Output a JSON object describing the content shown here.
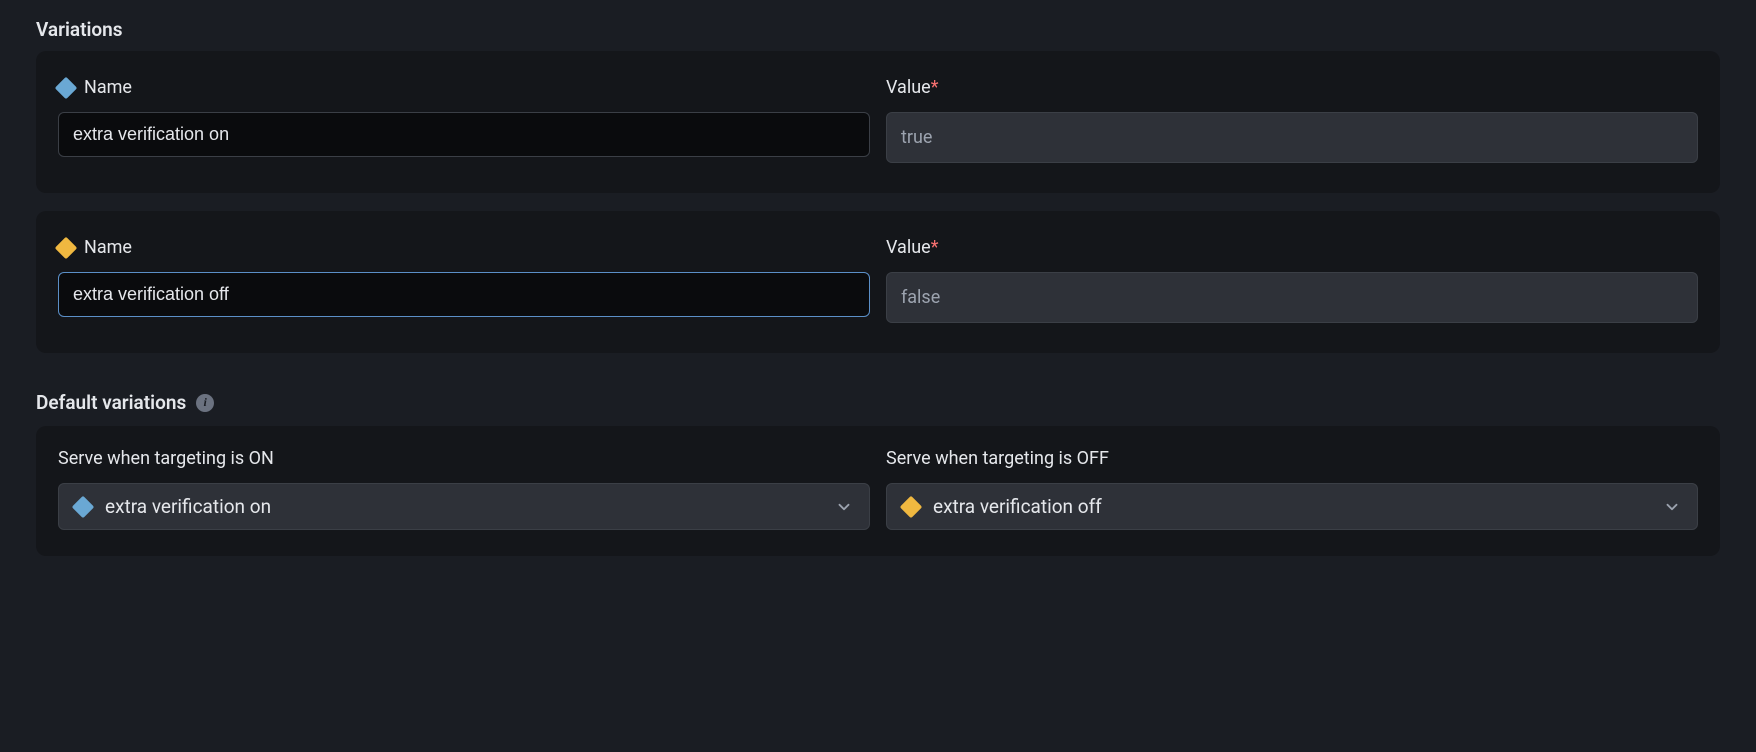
{
  "sections": {
    "variations_heading": "Variations",
    "defaults_heading": "Default variations"
  },
  "labels": {
    "name": "Name",
    "value": "Value",
    "required_star": "*",
    "serve_on": "Serve when targeting is ON",
    "serve_off": "Serve when targeting is OFF"
  },
  "variations": [
    {
      "icon_color": "blue",
      "name": "extra verification on",
      "value": "true",
      "focused": false
    },
    {
      "icon_color": "yellow",
      "name": "extra verification off",
      "value": "false",
      "focused": true
    }
  ],
  "defaults": {
    "on": {
      "icon_color": "blue",
      "label": "extra verification on"
    },
    "off": {
      "icon_color": "yellow",
      "label": "extra verification off"
    }
  }
}
